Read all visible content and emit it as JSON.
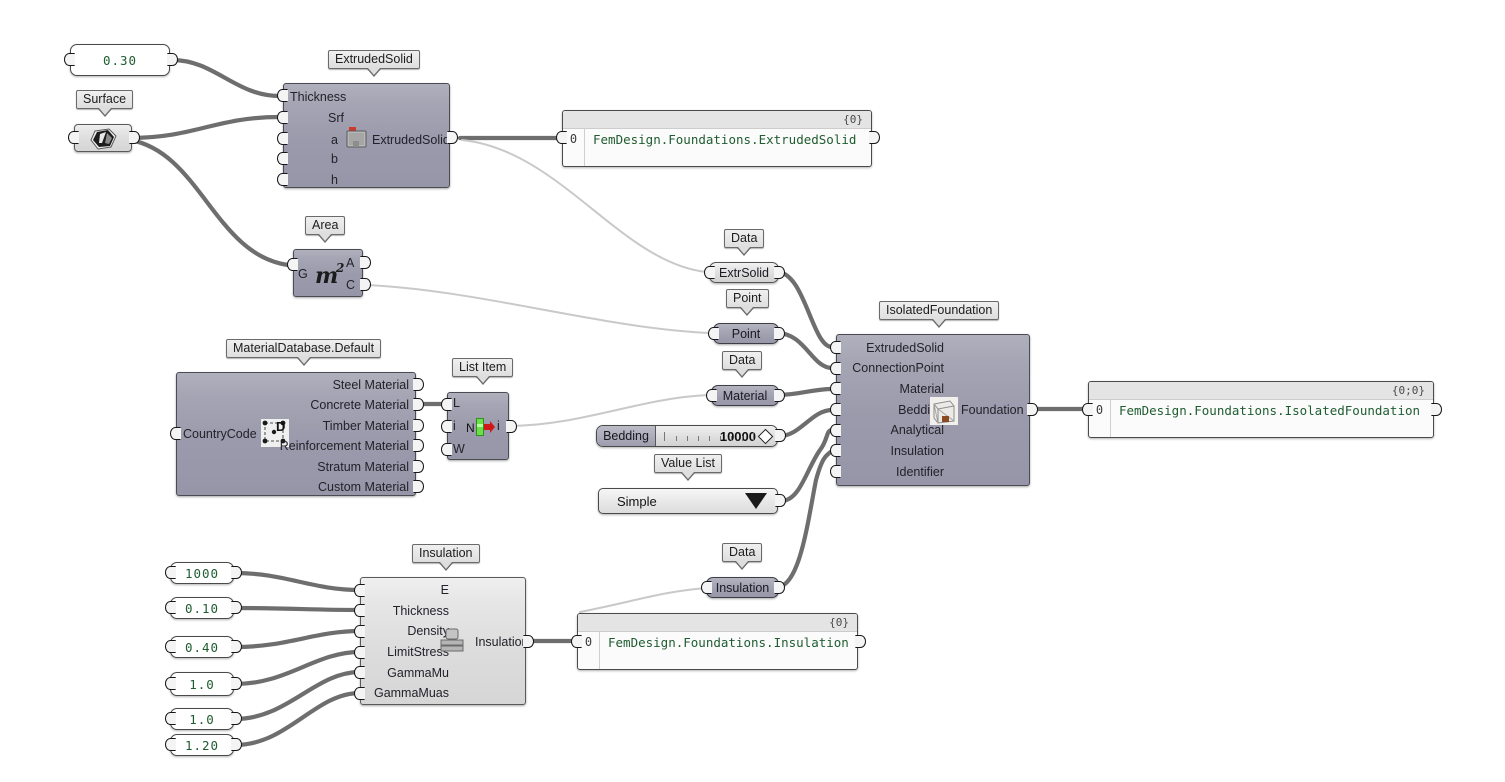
{
  "nodes": {
    "thickness_slider": {
      "value": "0.30"
    },
    "surface_param": {
      "tag": "Surface",
      "icon": "surface-icon"
    },
    "extruded_solid": {
      "tag": "ExtrudedSolid",
      "inputs": [
        "Thickness",
        "Srf",
        "a",
        "b",
        "h"
      ],
      "outputs": [
        "ExtrudedSolid"
      ],
      "icon": "extruded-solid-icon"
    },
    "panel_extruded": {
      "count": "{0}",
      "index": "0",
      "text": "FemDesign.Foundations.ExtrudedSolid"
    },
    "area": {
      "tag": "Area",
      "inputs": [
        "G"
      ],
      "outputs": [
        "A",
        "C"
      ],
      "icon": "area-m2-icon"
    },
    "material_database": {
      "tag": "MaterialDatabase.Default",
      "inputs": [
        "CountryCode"
      ],
      "outputs": [
        "Steel Material",
        "Concrete Material",
        "Timber Material",
        "Reinforcement Material",
        "Stratum Material",
        "Custom Material"
      ],
      "icon": "material-database-icon"
    },
    "list_item": {
      "tag": "List Item",
      "inputs": [
        "L",
        "i",
        "W"
      ],
      "outputs": [
        "i"
      ],
      "icon": "list-item-icon"
    },
    "capsules": [
      {
        "label": "ExtrSolid",
        "tag": "Data",
        "style": "pale"
      },
      {
        "label": "Point",
        "tag": "Point",
        "style": "dark"
      },
      {
        "label": "Material",
        "tag": "Data",
        "style": "dark"
      },
      {
        "label": "Insulation",
        "tag": "Data",
        "style": "dark"
      }
    ],
    "bedding_slider": {
      "name": "Bedding",
      "value": "10000"
    },
    "value_list": {
      "tag": "Value List",
      "selected": "Simple"
    },
    "isolated_foundation": {
      "tag": "IsolatedFoundation",
      "inputs": [
        "ExtrudedSolid",
        "ConnectionPoint",
        "Material",
        "Bedding",
        "Analytical",
        "Insulation",
        "Identifier"
      ],
      "outputs": [
        "Foundation"
      ],
      "icon": "isolated-foundation-icon"
    },
    "panel_foundation": {
      "count": "{0;0}",
      "index": "0",
      "text": "FemDesign.Foundations.IsolatedFoundation"
    },
    "insulation": {
      "tag": "Insulation",
      "inputs": [
        "E",
        "Thickness",
        "Density",
        "LimitStress",
        "GammaMu",
        "GammaMuas"
      ],
      "outputs": [
        "Insulation"
      ],
      "icon": "insulation-icon"
    },
    "insulation_sliders": [
      {
        "value": "1000"
      },
      {
        "value": "0.10"
      },
      {
        "value": "0.40"
      },
      {
        "value": "1.0"
      },
      {
        "value": "1.0"
      },
      {
        "value": "1.20"
      }
    ],
    "panel_insulation": {
      "count": "{0}",
      "index": "0",
      "text": "FemDesign.Foundations.Insulation"
    }
  },
  "colors": {
    "canvas": "#ffffff",
    "node_fill": "#9a9aac",
    "node_light": "#dcdcdc",
    "wire": "#6e6e6e",
    "wire_thin": "#c9c9c9",
    "panel_text": "#1f5c30"
  }
}
